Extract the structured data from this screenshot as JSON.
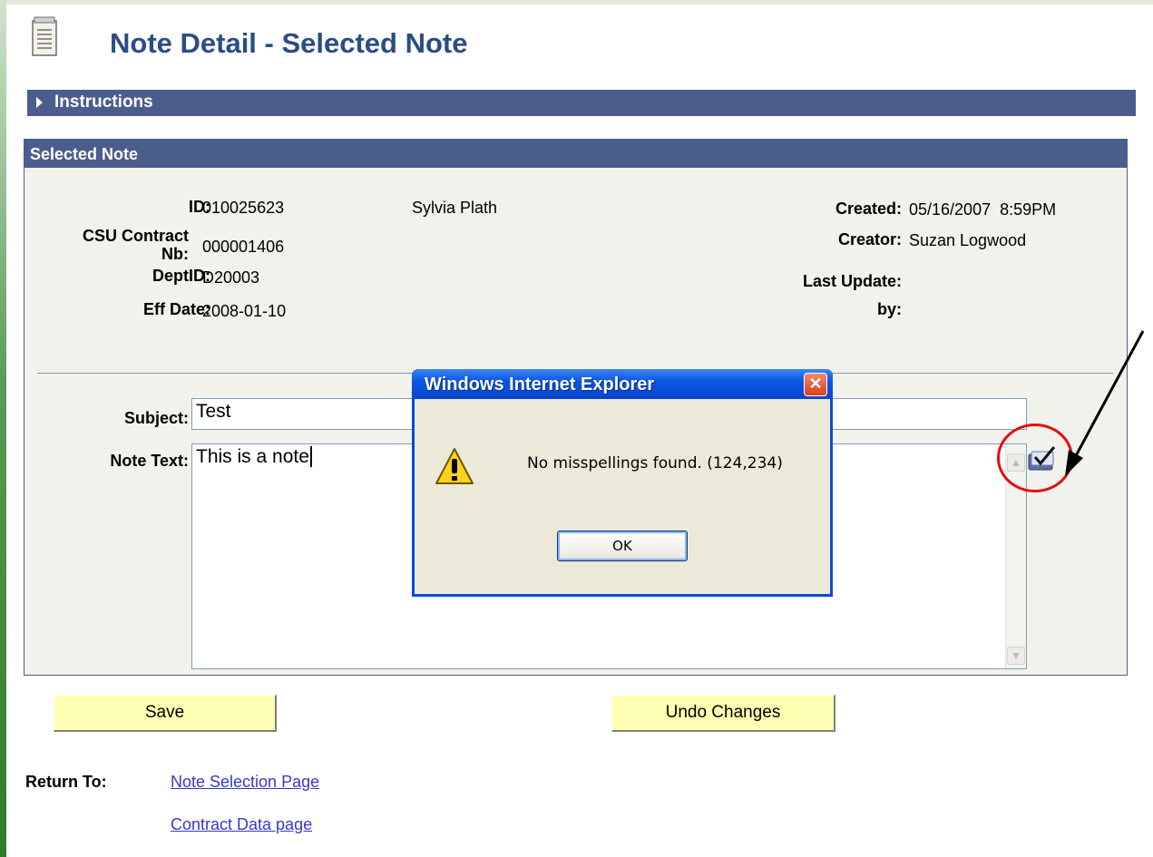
{
  "page": {
    "title": "Note Detail - Selected Note",
    "instructions_label": "Instructions"
  },
  "selected_note": {
    "header": "Selected Note",
    "id_label": "ID:",
    "id_value": "010025623",
    "name": "Sylvia Plath",
    "contract_label_line1": "CSU Contract",
    "contract_label_line2": "Nb:",
    "contract_value": "000001406",
    "dept_label": "DeptID:",
    "dept_value": "D20003",
    "effdate_label": "Eff Date:",
    "effdate_value": "2008-01-10",
    "created_label": "Created:",
    "created_value": "05/16/2007  8:59PM",
    "creator_label": "Creator:",
    "creator_value": "Suzan Logwood",
    "lastupdate_label": "Last Update:",
    "by_label": "by:",
    "subject_label": "Subject:",
    "subject_value": "Test",
    "notetext_label": "Note Text:",
    "notetext_value": "This is a note"
  },
  "dialog": {
    "title": "Windows Internet Explorer",
    "message": "No misspellings found. (124,234)",
    "ok_label": "OK",
    "close_glyph": "✕"
  },
  "buttons": {
    "save_label": "Save",
    "undo_label": "Undo Changes"
  },
  "return_to": {
    "label": "Return To:",
    "links": [
      "Note Selection Page",
      "Contract Data page"
    ]
  },
  "icons": {
    "page": "notepad-icon",
    "spell_check": "spell-check-icon",
    "warning": "warning-icon"
  },
  "colors": {
    "section_bar": "#4b5d8d",
    "title_text": "#2a4d85",
    "button_fill": "#ffffb3",
    "annotation": "#e60d0d",
    "link": "#3a38c4"
  }
}
